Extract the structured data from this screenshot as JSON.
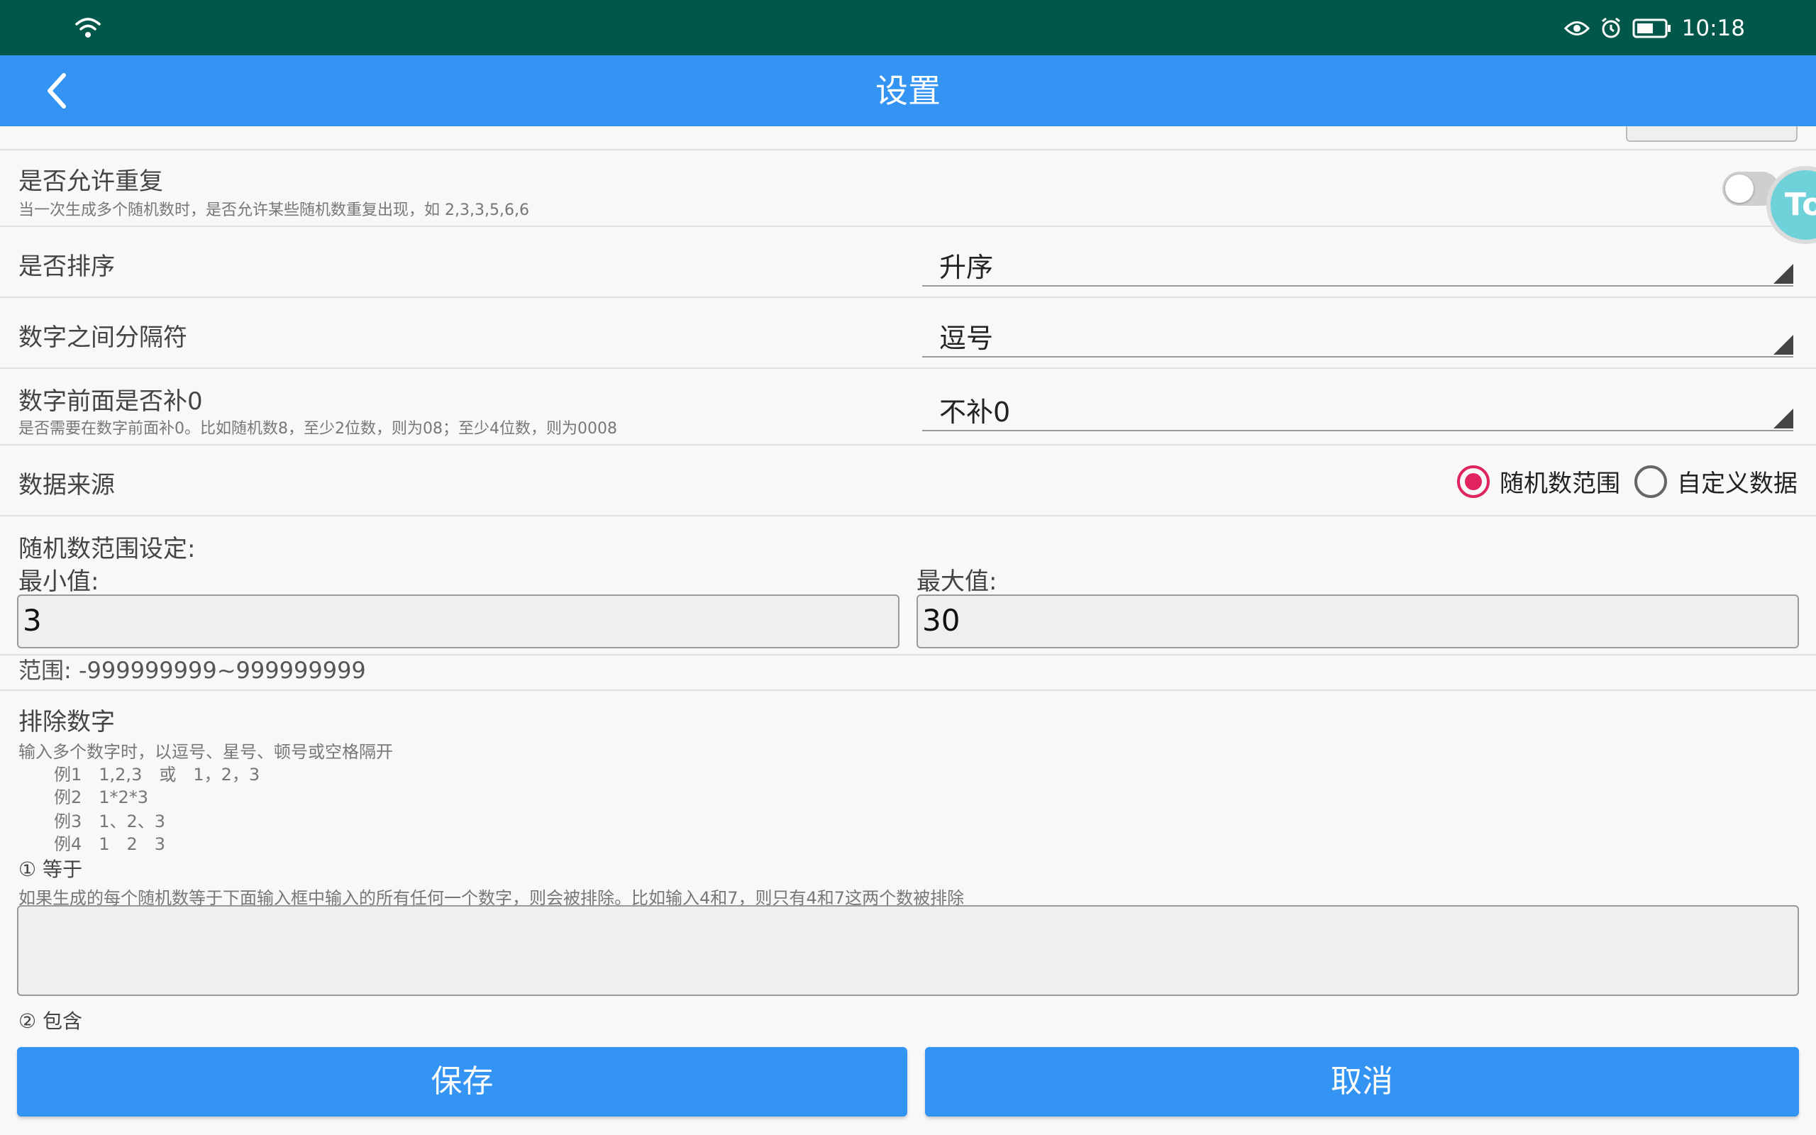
{
  "status_bar": {
    "time": "10:18",
    "icons": [
      "wifi-icon",
      "eye-icon",
      "alarm-icon",
      "battery-icon"
    ]
  },
  "app_bar": {
    "title": "设置",
    "back_icon": "chevron-left-icon"
  },
  "settings": {
    "allow_repeat": {
      "label": "是否允许重复",
      "description": "当一次生成多个随机数时，是否允许某些随机数重复出现，如 2,3,3,5,6,6",
      "enabled": false
    },
    "sort": {
      "label": "是否排序",
      "value": "升序"
    },
    "separator": {
      "label": "数字之间分隔符",
      "value": "逗号"
    },
    "zero_pad": {
      "label": "数字前面是否补0",
      "description": "是否需要在数字前面补0。比如随机数8，至少2位数，则为08；至少4位数，则为0008",
      "value": "不补0"
    },
    "data_source": {
      "label": "数据来源",
      "options": [
        "随机数范围",
        "自定义数据"
      ],
      "selected": "随机数范围"
    },
    "range": {
      "title": "随机数范围设定:",
      "min_label": "最小值:",
      "min_value": "3",
      "max_label": "最大值:",
      "max_value": "30",
      "hint": "范围: -999999999~999999999"
    },
    "exclude": {
      "title": "排除数字",
      "description": "输入多个数字时，以逗号、星号、顿号或空格隔开",
      "examples": [
        "例1　1,2,3　或　1，2，3",
        "例2　1*2*3",
        "例3　1、2、3",
        "例4　1　2　3"
      ],
      "equals_label": "① 等于",
      "equals_desc": "如果生成的每个随机数等于下面输入框中输入的所有任何一个数字，则会被排除。比如输入4和7，则只有4和7这两个数被排除",
      "equals_value": "",
      "contains_label": "② 包含"
    }
  },
  "floating_button": {
    "text": "To"
  },
  "buttons": {
    "save": "保存",
    "cancel": "取消"
  },
  "colors": {
    "status_bar": "#02574b",
    "app_bar": "#3494f4",
    "radio_selected": "#e0245e",
    "button": "#3494f4"
  }
}
